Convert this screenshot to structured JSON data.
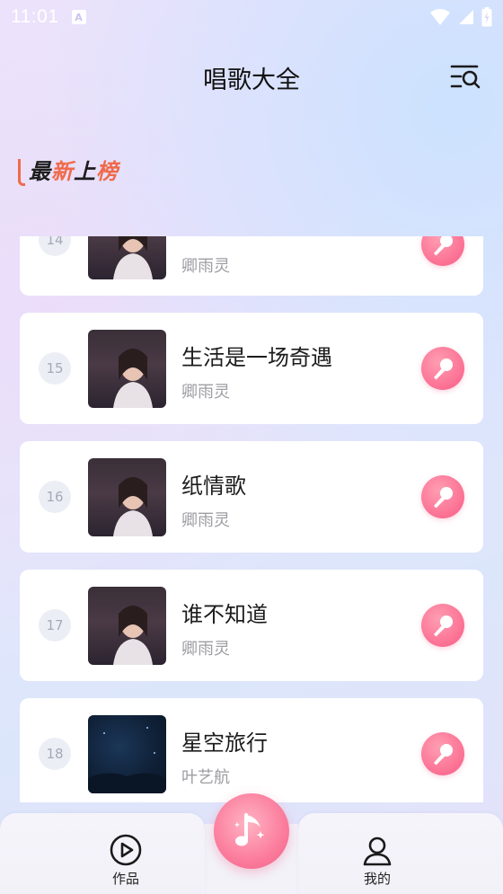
{
  "status_bar": {
    "time": "11:01",
    "notification_icon": "a-badge-icon",
    "icons": [
      "wifi-icon",
      "signal-icon",
      "battery-icon"
    ]
  },
  "header": {
    "title": "唱歌大全",
    "search_icon": "list-search-icon"
  },
  "section": {
    "logo_chars": [
      "最",
      "新",
      "上",
      "榜"
    ],
    "logo_colors": [
      "#1d1d1d",
      "#f06a4a",
      "#1d1d1d",
      "#f06a4a"
    ]
  },
  "songs": [
    {
      "rank": "14",
      "title": "",
      "artist": "卿雨灵",
      "cover": "cover-a"
    },
    {
      "rank": "15",
      "title": "生活是一场奇遇",
      "artist": "卿雨灵",
      "cover": "cover-a"
    },
    {
      "rank": "16",
      "title": "纸情歌",
      "artist": "卿雨灵",
      "cover": "cover-a"
    },
    {
      "rank": "17",
      "title": "谁不知道",
      "artist": "卿雨灵",
      "cover": "cover-a"
    },
    {
      "rank": "18",
      "title": "星空旅行",
      "artist": "叶艺航",
      "cover": "cover-b"
    }
  ],
  "tabs": {
    "left_label": "作品",
    "right_label": "我的",
    "center_icon": "music-note-icon"
  },
  "colors": {
    "accent_pink": "#fb6f93",
    "rank_bg": "#eceef5",
    "artist_gray": "#9d9da3"
  }
}
